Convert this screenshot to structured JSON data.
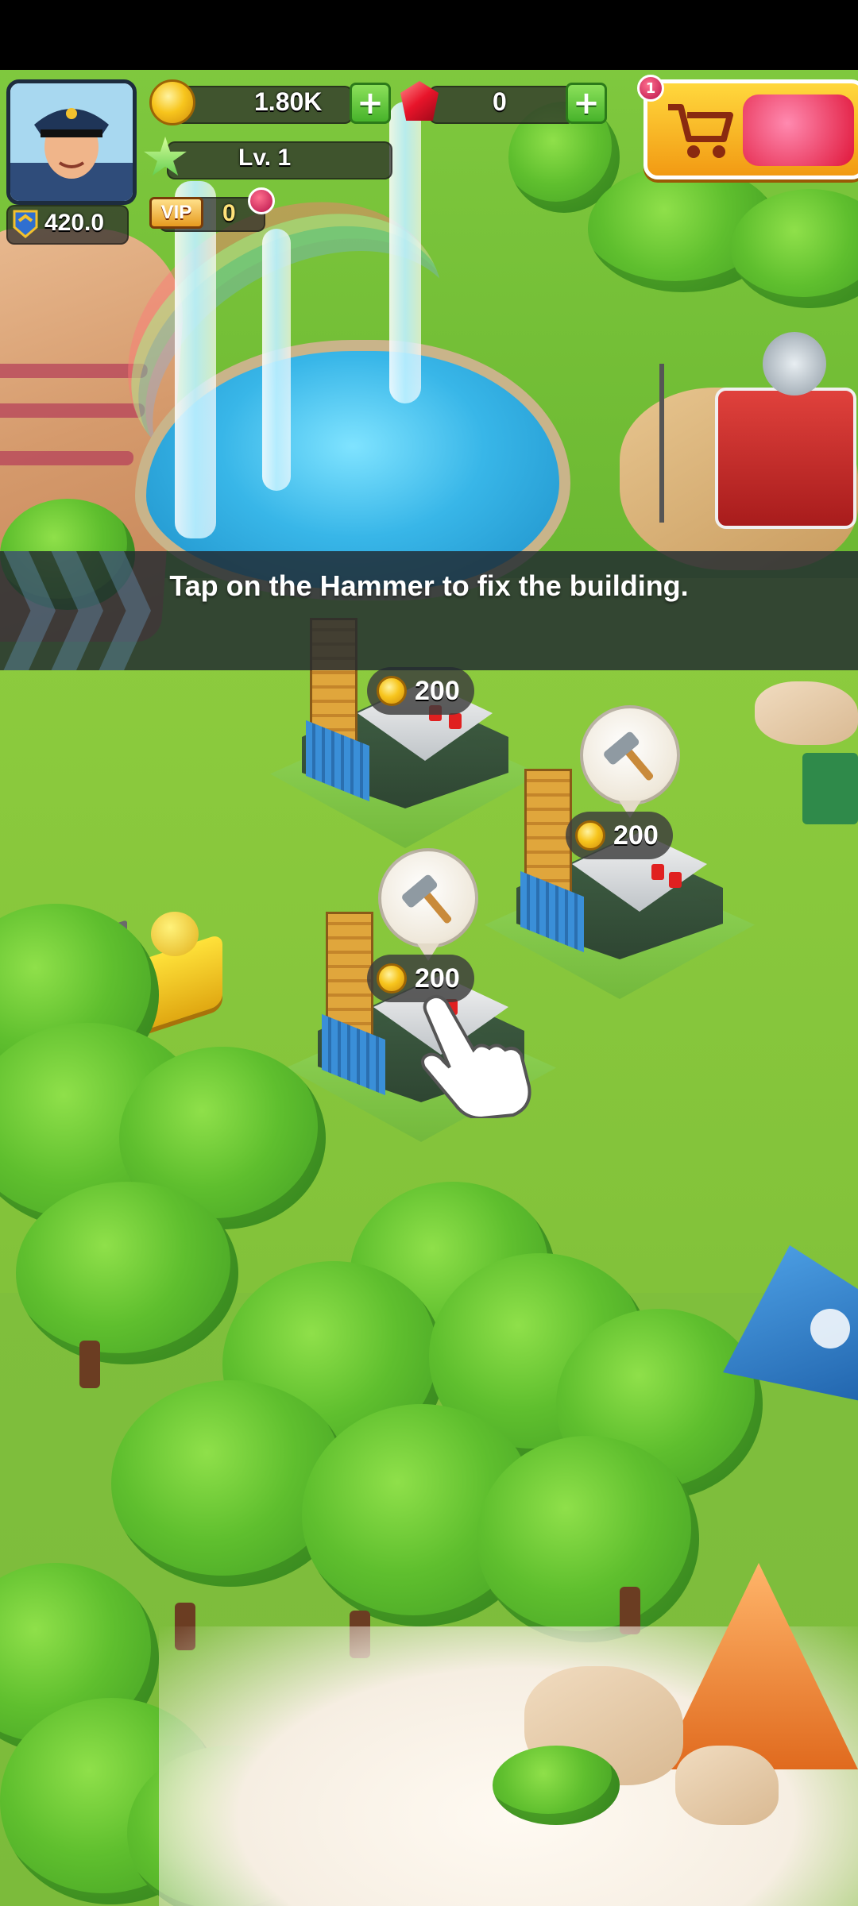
{
  "hud": {
    "power": "420.0",
    "coins": "1.80K",
    "gems": "0",
    "level": "Lv. 1",
    "vip_label": "VIP",
    "vip_value": "0",
    "shop_notification": "1"
  },
  "tutorial": {
    "message": "Tap on the Hammer to fix the building."
  },
  "buildings": [
    {
      "repair_cost": "200"
    },
    {
      "repair_cost": "200"
    },
    {
      "repair_cost": "200"
    }
  ],
  "icons": {
    "avatar": "captain-avatar-icon",
    "power": "chevron-rank-icon",
    "coin": "gold-coin-icon",
    "gem": "red-gem-icon",
    "star": "level-star-icon",
    "hammer": "hammer-icon",
    "shop": "shop-cart-icon",
    "pointer": "pointing-hand-icon"
  },
  "colors": {
    "grass": "#82c23a",
    "banner": "#202830",
    "plus_button": "#47b32a",
    "shop_button": "#f29a13",
    "notification": "#b8124a"
  }
}
